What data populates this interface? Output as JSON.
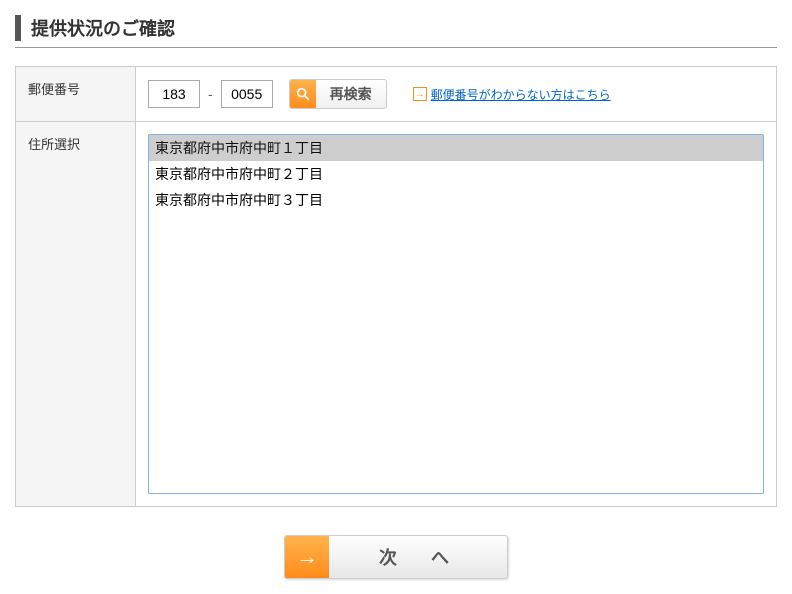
{
  "title": "提供状況のご確認",
  "form": {
    "postal_label": "郵便番号",
    "postal1": "183",
    "postal2": "0055",
    "search_label": "再検索",
    "help_link": "郵便番号がわからない方はこちら",
    "address_label": "住所選択",
    "addresses": [
      "東京都府中市府中町１丁目",
      "東京都府中市府中町２丁目",
      "東京都府中市府中町３丁目"
    ]
  },
  "next_label": "次　へ"
}
